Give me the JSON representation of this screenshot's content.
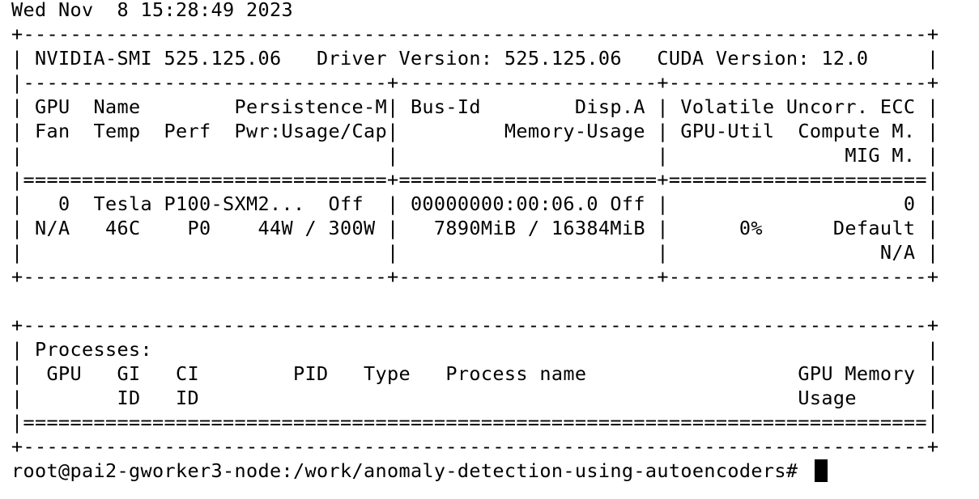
{
  "terminal": {
    "lines": [
      "Wed Nov  8 15:28:49 2023",
      "+-----------------------------------------------------------------------------+",
      "| NVIDIA-SMI 525.125.06   Driver Version: 525.125.06   CUDA Version: 12.0     |",
      "|-------------------------------+----------------------+----------------------+",
      "| GPU  Name        Persistence-M| Bus-Id        Disp.A | Volatile Uncorr. ECC |",
      "| Fan  Temp  Perf  Pwr:Usage/Cap|         Memory-Usage | GPU-Util  Compute M. |",
      "|                               |                      |               MIG M. |",
      "|===============================+======================+======================|",
      "|   0  Tesla P100-SXM2...  Off  | 00000000:00:06.0 Off |                    0 |",
      "| N/A   46C    P0    44W / 300W |   7890MiB / 16384MiB |      0%      Default |",
      "|                               |                      |                  N/A |",
      "+-------------------------------+----------------------+----------------------+",
      "",
      "+-----------------------------------------------------------------------------+",
      "| Processes:                                                                  |",
      "|  GPU   GI   CI        PID   Type   Process name                  GPU Memory |",
      "|        ID   ID                                                   Usage      |",
      "|=============================================================================|",
      "+-----------------------------------------------------------------------------+"
    ],
    "prompt": "root@pai2-gworker3-node:/work/anomaly-detection-using-autoencoders# "
  }
}
